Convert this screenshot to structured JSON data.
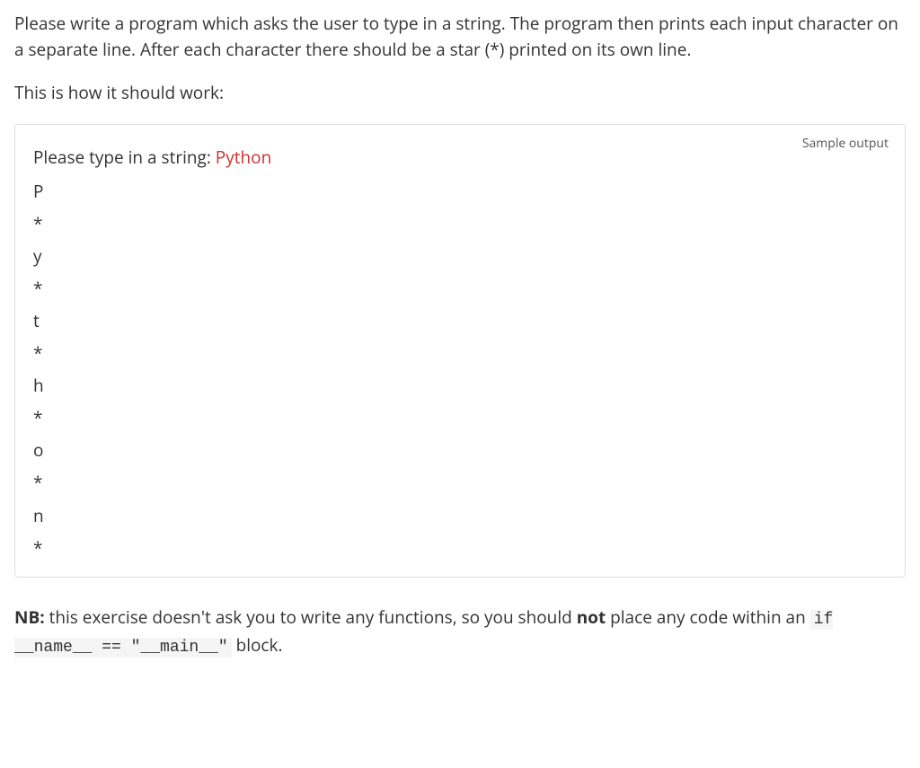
{
  "intro": {
    "paragraph1": "Please write a program which asks the user to type in a string. The program then prints each input character on a separate line. After each character there should be a star (*) printed on its own line.",
    "paragraph2": "This is how it should work:"
  },
  "output": {
    "label": "Sample output",
    "prompt": "Please type in a string: ",
    "userInput": "Python",
    "lines": [
      "P",
      "*",
      "y",
      "*",
      "t",
      "*",
      "h",
      "*",
      "o",
      "*",
      "n",
      "*"
    ]
  },
  "note": {
    "prefix": "NB:",
    "text1": " this exercise doesn't ask you to write any functions, so you should ",
    "bold": "not",
    "text2": " place any code within an ",
    "code": "if __name__ == \"__main__\"",
    "text3": " block."
  }
}
